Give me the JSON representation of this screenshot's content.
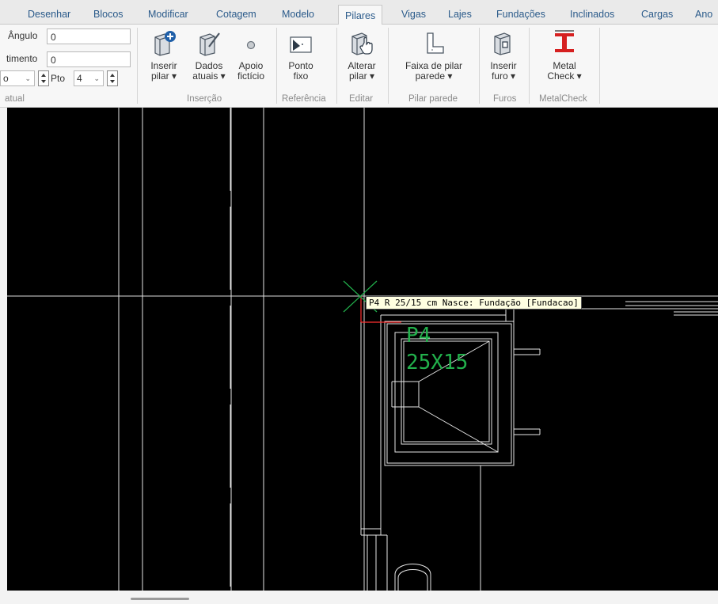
{
  "tabs": [
    {
      "label": "Desenhar",
      "active": false
    },
    {
      "label": "Blocos",
      "active": false
    },
    {
      "label": "Modificar",
      "active": false
    },
    {
      "label": "Cotagem",
      "active": false
    },
    {
      "label": "Modelo",
      "active": false
    },
    {
      "label": "Pilares",
      "active": true
    },
    {
      "label": "Vigas",
      "active": false
    },
    {
      "label": "Lajes",
      "active": false
    },
    {
      "label": "Fundações",
      "active": false
    },
    {
      "label": "Inclinados",
      "active": false
    },
    {
      "label": "Cargas",
      "active": false
    },
    {
      "label": "Ano",
      "active": false
    }
  ],
  "current_panel": {
    "angulo_label": "Ângulo",
    "angulo_value": "0",
    "deslocamento_label": "timento",
    "deslocamento_value": "0",
    "combo1_value": "o",
    "pto_label": "Pto",
    "pto_value": "4",
    "group_label": "atual"
  },
  "groups": {
    "insercao": {
      "label": "Inserção",
      "inserir_pilar": [
        "Inserir",
        "pilar ▾"
      ],
      "dados_atuais": [
        "Dados",
        "atuais ▾"
      ],
      "apoio_ficticio": [
        "Apoio",
        "fictício"
      ]
    },
    "referencia": {
      "label": "Referência",
      "ponto_fixo": [
        "Ponto",
        "fixo"
      ]
    },
    "editar": {
      "label": "Editar",
      "alterar_pilar": [
        "Alterar",
        "pilar ▾"
      ]
    },
    "pilar_parede": {
      "label": "Pilar parede",
      "faixa": [
        "Faixa de pilar",
        "parede ▾"
      ]
    },
    "furos": {
      "label": "Furos",
      "inserir_furo": [
        "Inserir",
        "furo ▾"
      ]
    },
    "metalcheck": {
      "label": "MetalCheck",
      "metal_check": [
        "Metal",
        "Check ▾"
      ]
    }
  },
  "canvas": {
    "tooltip": "P4 R 25/15 cm Nasce: Fundação [Fundacao]",
    "pillar_name": "P4",
    "pillar_dims": "25X15",
    "colors": {
      "background": "#000000",
      "lines": "#e6e6e6",
      "pillar_text": "#22b14c",
      "cursor": "#22b14c",
      "axis": "#ff3030"
    }
  }
}
